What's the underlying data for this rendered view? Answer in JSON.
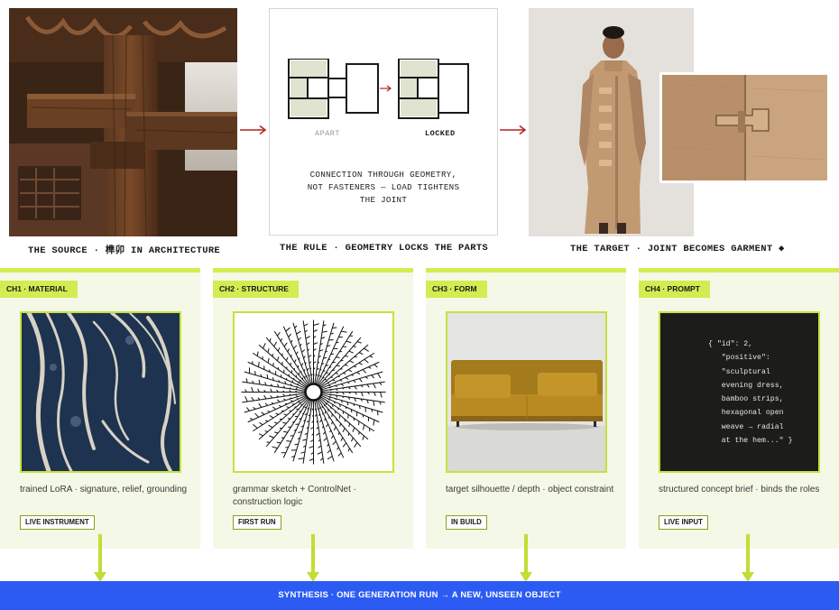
{
  "top": {
    "source_caption": "THE SOURCE · 榫卯 IN ARCHITECTURE",
    "rule_caption": "THE RULE · GEOMETRY LOCKS THE PARTS",
    "target_caption": "THE TARGET · JOINT BECOMES GARMENT ◆",
    "rule_label_apart": "APART",
    "rule_label_locked": "LOCKED",
    "rule_text_line1": "CONNECTION THROUGH GEOMETRY,",
    "rule_text_line2": "NOT FASTENERS — LOAD TIGHTENS",
    "rule_text_line3": "THE JOINT"
  },
  "cards": [
    {
      "tag": "CH1 · MATERIAL",
      "desc": "trained LoRA · signature, relief, grounding",
      "badge": "LIVE INSTRUMENT"
    },
    {
      "tag": "CH2 · STRUCTURE",
      "desc": "grammar sketch + ControlNet · construction logic",
      "badge": "FIRST RUN"
    },
    {
      "tag": "CH3 · FORM",
      "desc": "target silhouette / depth · object constraint",
      "badge": "IN BUILD"
    },
    {
      "tag": "CH4 · PROMPT",
      "desc": "structured concept brief · binds the roles",
      "badge": "LIVE INPUT"
    }
  ],
  "prompt_code": "{ \"id\": 2,\n   \"positive\":\n   \"sculptural\n   evening dress,\n   bamboo strips,\n   hexagonal open\n   weave → radial\n   at the hem...\" }",
  "synthesis": "SYNTHESIS · ONE GENERATION RUN → A NEW, UNSEEN OBJECT",
  "colors": {
    "accent_green": "#d4ec52",
    "card_bg": "#f4f8e6",
    "arrow_red": "#b3261e",
    "synthesis_blue": "#2b5bf2"
  },
  "icons": [
    "arrow-right-icon",
    "arrow-down-icon",
    "diamond-icon"
  ]
}
